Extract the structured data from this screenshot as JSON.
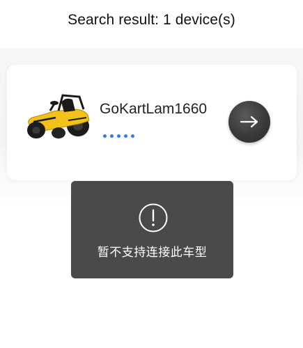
{
  "header": {
    "title": "Search result: 1 device(s)"
  },
  "device": {
    "name": "GoKartLam1660",
    "image_icon": "gokart-icon",
    "status": "connecting-dots",
    "action_icon": "arrow-right-icon"
  },
  "toast": {
    "icon": "exclamation-icon",
    "message": "暂不支持连接此车型"
  },
  "colors": {
    "accent": "#2f7fd6",
    "toast_bg": "#4a4a4a",
    "button_bg": "#3a3a3a"
  }
}
